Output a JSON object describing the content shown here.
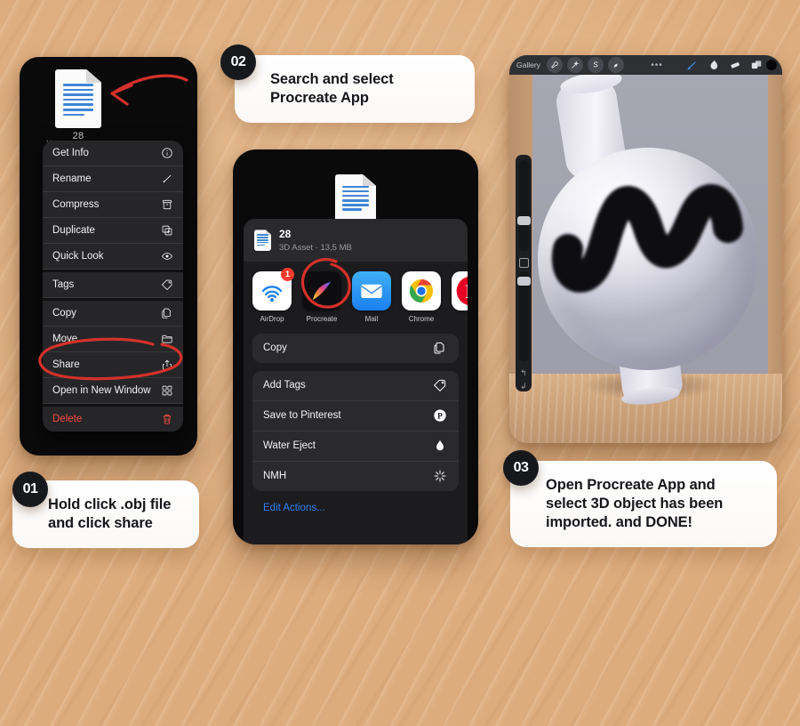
{
  "background_color": "#dcac7d",
  "panel1": {
    "file_name": "28",
    "owner_hint": "You",
    "menu": [
      {
        "label": "Get Info",
        "icon": "info-circle-icon"
      },
      {
        "label": "Rename",
        "icon": "pencil-icon"
      },
      {
        "label": "Compress",
        "icon": "archive-box-icon"
      },
      {
        "label": "Duplicate",
        "icon": "duplicate-icon"
      },
      {
        "label": "Quick Look",
        "icon": "eye-icon"
      },
      {
        "label": "Tags",
        "icon": "tag-icon"
      },
      {
        "label": "Copy",
        "icon": "copy-icon"
      },
      {
        "label": "Move",
        "icon": "folder-icon"
      },
      {
        "label": "Share",
        "icon": "share-arrow-icon"
      },
      {
        "label": "Open in New Window",
        "icon": "grid-windows-icon"
      },
      {
        "label": "Delete",
        "icon": "trash-icon"
      }
    ],
    "annotations": [
      "red-arrow-to-file",
      "red-ellipse-around-share"
    ]
  },
  "panel2": {
    "file": {
      "name": "28",
      "subtitle": "3D Asset · 13,5 MB"
    },
    "apps": [
      {
        "label": "AirDrop",
        "icon": "airdrop-icon",
        "badge": "1"
      },
      {
        "label": "Procreate",
        "icon": "procreate-icon",
        "badge": ""
      },
      {
        "label": "Mail",
        "icon": "mail-icon",
        "badge": ""
      },
      {
        "label": "Chrome",
        "icon": "chrome-icon",
        "badge": ""
      },
      {
        "label": "Pi",
        "icon": "pinterest-icon",
        "badge": ""
      }
    ],
    "actions_primary": [
      {
        "label": "Copy",
        "icon": "copy-icon"
      }
    ],
    "actions_secondary": [
      {
        "label": "Add Tags",
        "icon": "tag-icon"
      },
      {
        "label": "Save to Pinterest",
        "icon": "pinterest-icon"
      },
      {
        "label": "Water Eject",
        "icon": "water-drop-icon"
      },
      {
        "label": "NMH",
        "icon": "sparkle-burst-icon"
      }
    ],
    "edit_actions": "Edit Actions...",
    "annotation": "red-circle-around-procreate"
  },
  "panel3": {
    "toolbar_left_label": "Gallery",
    "toolbar_left_icons": [
      "wrench-icon",
      "magic-wand-icon",
      "selection-s-icon",
      "transform-arrow-icon"
    ],
    "toolbar_center": "•••",
    "toolbar_right_icons": [
      "brush-icon",
      "smudge-icon",
      "eraser-icon",
      "layers-icon"
    ],
    "color_swatch": "#2f7ff0",
    "sidebar_icons": [
      "brush-size-slider",
      "square-modify-icon",
      "brush-opacity-slider",
      "undo-icon",
      "redo-icon"
    ],
    "artwork": "3d-object-white-sphere-with-black-squiggle"
  },
  "steps": [
    {
      "number": "01",
      "text": "Hold click .obj file\nand click share"
    },
    {
      "number": "02",
      "text": "Search and select\nProcreate App"
    },
    {
      "number": "03",
      "text": "Open Procreate App and\nselect 3D object has been\nimported. and DONE!"
    }
  ]
}
